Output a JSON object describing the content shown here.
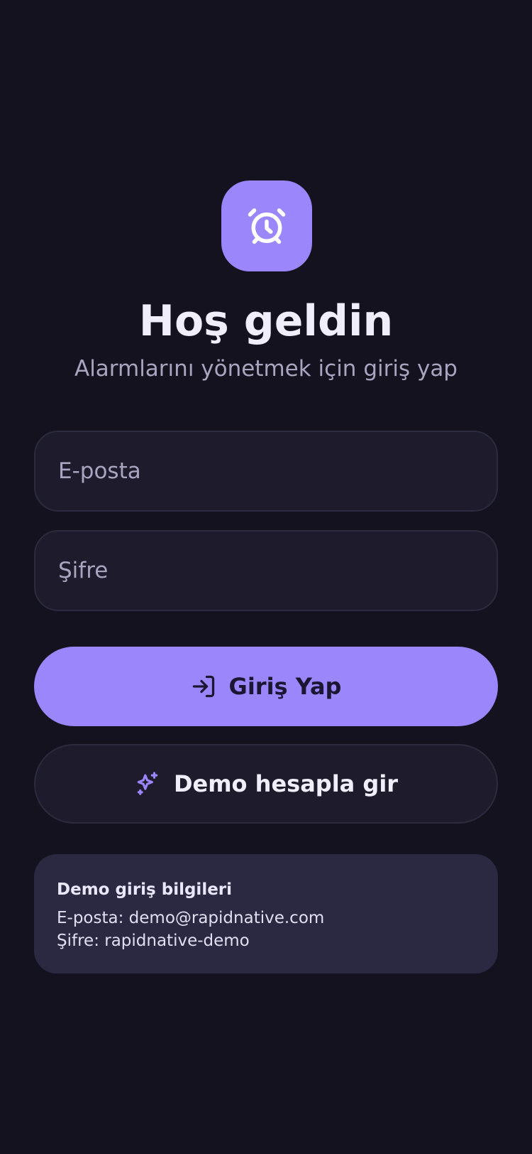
{
  "logo": {
    "icon": "alarm-clock-icon"
  },
  "header": {
    "title": "Hoş geldin",
    "subtitle": "Alarmlarını yönetmek için giriş yap"
  },
  "form": {
    "email_placeholder": "E-posta",
    "email_value": "",
    "password_placeholder": "Şifre",
    "password_value": ""
  },
  "actions": {
    "login_label": "Giriş Yap",
    "login_icon": "log-in-icon",
    "demo_label": "Demo hesapla gir",
    "demo_icon": "sparkles-icon"
  },
  "demo_info": {
    "title": "Demo giriş bilgileri",
    "email_line": "E-posta: demo@rapidnative.com",
    "password_line": "Şifre: rapidnative-demo"
  },
  "colors": {
    "background": "#13121e",
    "accent": "#9b87fb",
    "field_background": "#1d1b2c",
    "card_background": "#2b2842"
  }
}
